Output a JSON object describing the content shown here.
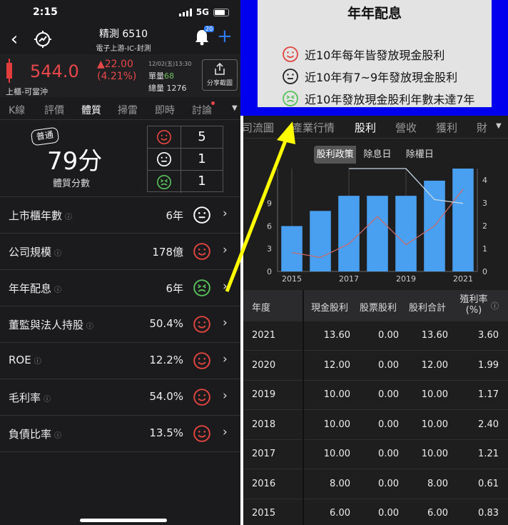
{
  "status_bar": {
    "time": "2:15",
    "network": "5G"
  },
  "nav": {
    "title": "精測 6510",
    "subtitle": "電子上游-IC-封測",
    "notification_count": "20"
  },
  "quote": {
    "price": "544.0",
    "change": "▲22.00",
    "change_pct": "(4.21%)",
    "date": "12/02(五)13:30",
    "unit_volume_label": "單量",
    "unit_volume": "68",
    "total_volume_label": "總量",
    "total_volume": "1276",
    "market": "上櫃-可當沖",
    "share_label": "分享截圖"
  },
  "tabs": [
    "K線",
    "評價",
    "體質",
    "掃雷",
    "即時",
    "討論"
  ],
  "active_tab": "體質",
  "score": {
    "badge": "普通",
    "value": "79分",
    "label": "體質分數",
    "counts": {
      "smile": "5",
      "neutral": "1",
      "frown": "1"
    }
  },
  "metrics": [
    {
      "label": "上市櫃年數",
      "value": "6年",
      "face": "neutral"
    },
    {
      "label": "公司規模",
      "value": "178億",
      "face": "smile"
    },
    {
      "label": "年年配息",
      "value": "6年",
      "face": "frown"
    },
    {
      "label": "董監與法人持股",
      "value": "50.4%",
      "face": "smile"
    },
    {
      "label": "ROE",
      "value": "12.2%",
      "face": "smile"
    },
    {
      "label": "毛利率",
      "value": "54.0%",
      "face": "smile"
    },
    {
      "label": "負債比率",
      "value": "13.5%",
      "face": "smile"
    }
  ],
  "info_icon": "ⓘ",
  "popup": {
    "title": "年年配息",
    "lines": [
      {
        "text": "近10年每年皆發放現金股利",
        "face": "smile"
      },
      {
        "text": "近10年有7~9年發放現金股利",
        "face": "neutral"
      },
      {
        "text": "近10年發放現金股利年數未達7年",
        "face": "frown"
      }
    ]
  },
  "right_tabs": [
    "司流圖",
    "產業行情",
    "股利",
    "營收",
    "獲利",
    "財"
  ],
  "right_active_tab": "股利",
  "segments": [
    "股利政策",
    "除息日",
    "除權日"
  ],
  "active_segment": "股利政策",
  "table": {
    "headers": [
      "年度",
      "現金股利",
      "股票股利",
      "股利合計",
      "殖利率\n(%)"
    ],
    "rows": [
      [
        "2021",
        "13.60",
        "0.00",
        "13.60",
        "3.60"
      ],
      [
        "2020",
        "12.00",
        "0.00",
        "12.00",
        "1.99"
      ],
      [
        "2019",
        "10.00",
        "0.00",
        "10.00",
        "1.17"
      ],
      [
        "2018",
        "10.00",
        "0.00",
        "10.00",
        "2.40"
      ],
      [
        "2017",
        "10.00",
        "0.00",
        "10.00",
        "1.21"
      ],
      [
        "2016",
        "8.00",
        "0.00",
        "8.00",
        "0.61"
      ],
      [
        "2015",
        "6.00",
        "0.00",
        "6.00",
        "0.83"
      ]
    ]
  },
  "chart_data": {
    "type": "bar",
    "x": [
      2015,
      2016,
      2017,
      2018,
      2019,
      2020,
      2021
    ],
    "x_tick_labels": [
      "2015",
      "2017",
      "2019",
      "2021"
    ],
    "left_ticks": [
      "0",
      "3",
      "6",
      "9"
    ],
    "right_ticks": [
      "0",
      "1",
      "2",
      "3",
      "4"
    ],
    "ylim_left": [
      0,
      13.6
    ],
    "ylim_right": [
      0,
      4.5
    ],
    "series": [
      {
        "type": "bar",
        "axis": "left",
        "values": [
          6.0,
          8.0,
          10.0,
          10.0,
          10.0,
          12.0,
          13.6
        ],
        "color": "#4aa0f0"
      },
      {
        "type": "line",
        "axis": "right",
        "values": [
          0.83,
          0.61,
          1.21,
          2.4,
          1.17,
          1.99,
          3.6
        ],
        "color": "#c86a6a"
      },
      {
        "type": "line",
        "axis": "left",
        "values": [
          null,
          null,
          13.6,
          13.6,
          13.6,
          9.5,
          9.0
        ],
        "color": "#c8d8e8"
      }
    ],
    "grid": "vertical"
  },
  "colors": {
    "up": "#e8474a",
    "accent": "#2f7bf5",
    "smile": "#e0453f",
    "neutral": "#ffffff",
    "frown": "#57c05a",
    "popup_border": "#0000ee",
    "arrow": "#ffff00"
  }
}
